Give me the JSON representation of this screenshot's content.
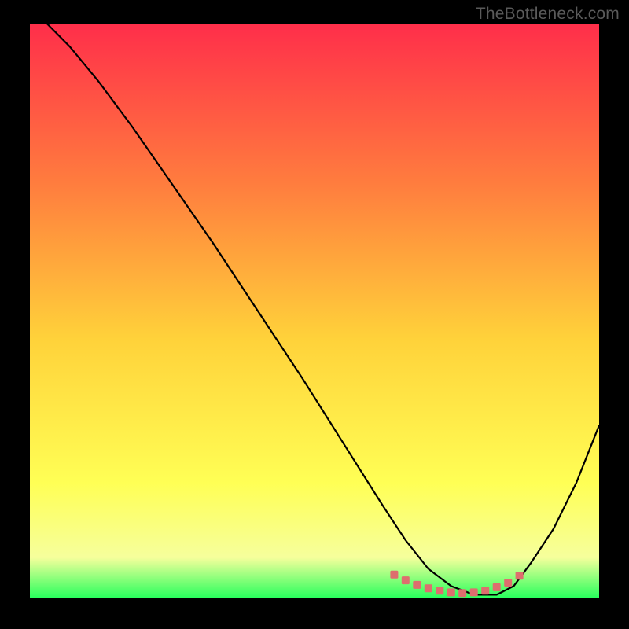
{
  "watermark": "TheBottleneck.com",
  "chart_data": {
    "type": "line",
    "title": "",
    "xlabel": "",
    "ylabel": "",
    "xlim": [
      0,
      100
    ],
    "ylim": [
      0,
      100
    ],
    "gradient_colors": {
      "top": "#ff2e4a",
      "upper_mid": "#ff7d3e",
      "mid": "#ffd23a",
      "lower_mid": "#ffff55",
      "bottom_band": "#f6ff9c",
      "bottom": "#2aff5d"
    },
    "curve": {
      "name": "bottleneck-curve",
      "color": "#000000",
      "x": [
        3,
        7,
        12,
        18,
        25,
        32,
        40,
        48,
        55,
        62,
        66,
        70,
        74,
        78,
        82,
        85,
        88,
        92,
        96,
        100
      ],
      "y": [
        100,
        96,
        90,
        82,
        72,
        62,
        50,
        38,
        27,
        16,
        10,
        5,
        2,
        0.5,
        0.5,
        2,
        6,
        12,
        20,
        30
      ]
    },
    "optimal_markers": {
      "name": "optimal-zone",
      "color": "#de6e6e",
      "x": [
        64,
        66,
        68,
        70,
        72,
        74,
        76,
        78,
        80,
        82,
        84,
        86
      ],
      "y": [
        4.0,
        3.0,
        2.2,
        1.6,
        1.2,
        0.9,
        0.8,
        0.9,
        1.2,
        1.8,
        2.6,
        3.8
      ]
    }
  }
}
